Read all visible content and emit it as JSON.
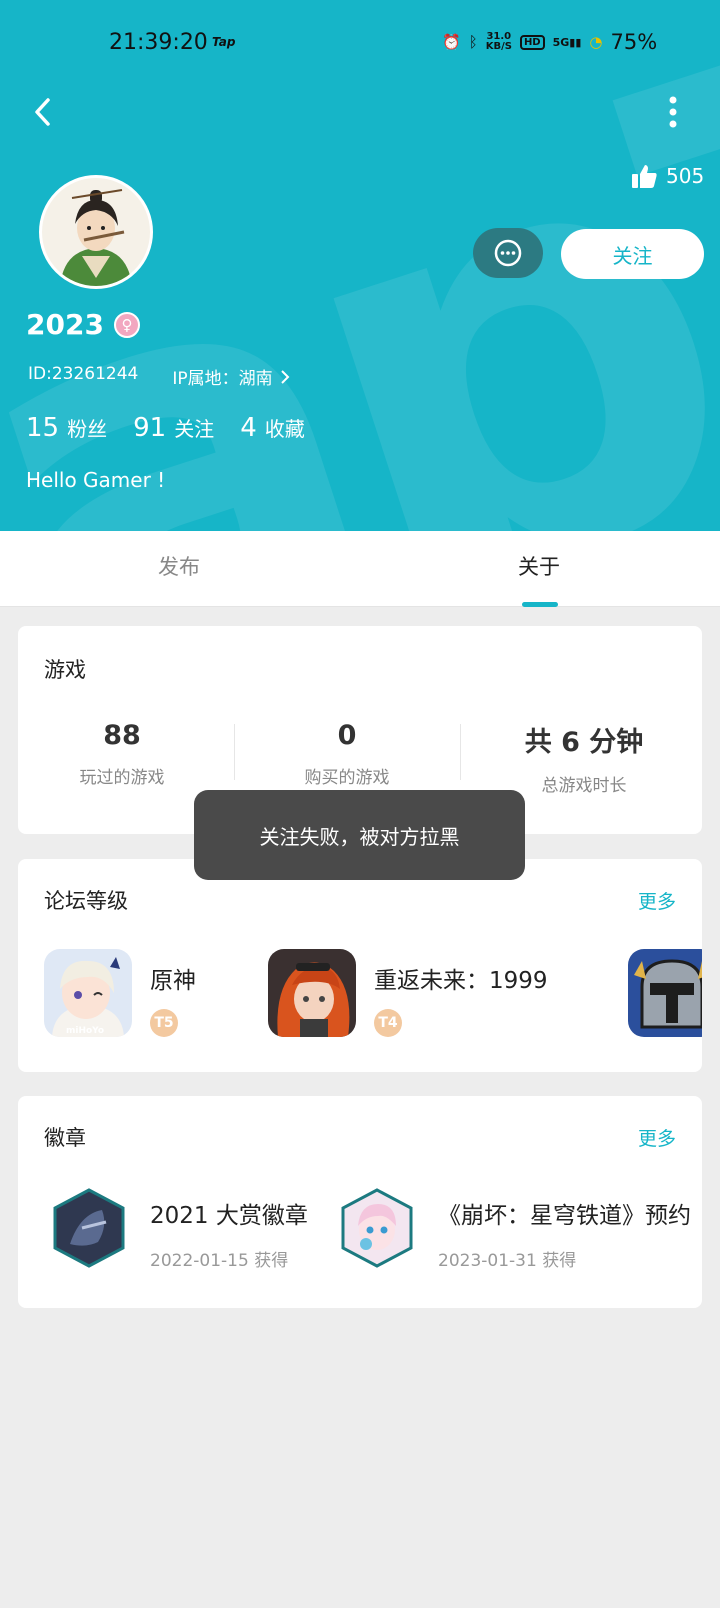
{
  "status_bar": {
    "time": "21:39:20",
    "app_label": "Tap",
    "speed_value": "31.0",
    "speed_unit": "KB/S",
    "hd": "HD",
    "network": "5G",
    "battery": "75%"
  },
  "profile": {
    "likes": "505",
    "follow_label": "关注",
    "username": "2023",
    "gender_symbol": "♀",
    "id_text": "ID:23261244",
    "ip_text": "IP属地：湖南",
    "stats": [
      {
        "num": "15",
        "label": "粉丝"
      },
      {
        "num": "91",
        "label": "关注"
      },
      {
        "num": "4",
        "label": "收藏"
      }
    ],
    "bio": "Hello Gamer !"
  },
  "tabs": [
    {
      "label": "发布",
      "active": false
    },
    {
      "label": "关于",
      "active": true
    }
  ],
  "games_card": {
    "title": "游戏",
    "stats": [
      {
        "value": "88",
        "label": "玩过的游戏"
      },
      {
        "value": "0",
        "label": "购买的游戏"
      },
      {
        "value": "共 6 分钟",
        "label": "总游戏时长"
      }
    ]
  },
  "forum_card": {
    "title": "论坛等级",
    "more": "更多",
    "items": [
      {
        "name": "原神",
        "level": "T5"
      },
      {
        "name": "重返未来：1999",
        "level": "T4"
      }
    ]
  },
  "badges_card": {
    "title": "徽章",
    "more": "更多",
    "items": [
      {
        "name": "2021 大赏徽章",
        "date": "2022-01-15 获得"
      },
      {
        "name": "《崩坏：星穹铁道》预约",
        "date": "2023-01-31 获得"
      }
    ]
  },
  "toast": "关注失败，被对方拉黑",
  "colors": {
    "accent": "#16b5c8",
    "chat_button": "#2c7a82",
    "toast_bg": "#4a4a4a"
  }
}
